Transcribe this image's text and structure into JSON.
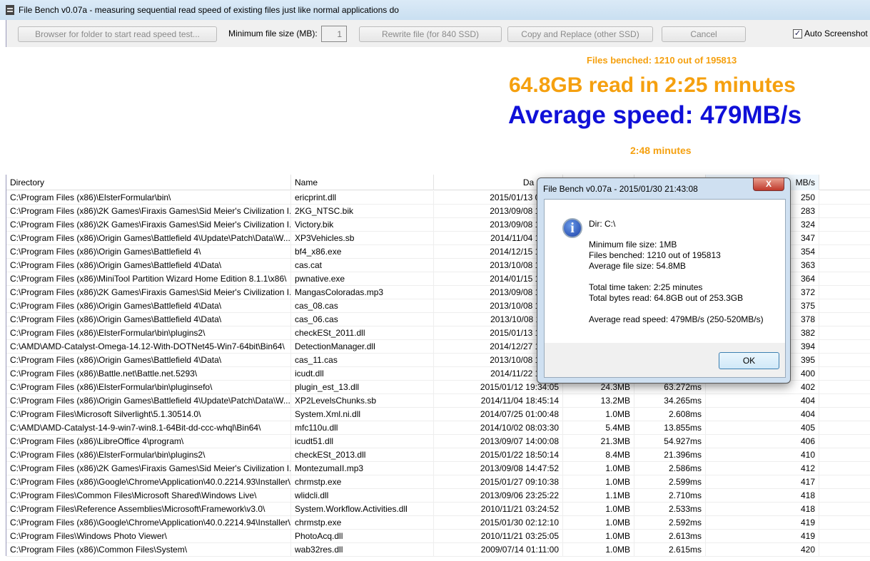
{
  "window": {
    "title": "File Bench v0.07a - measuring sequential read speed of existing files just like normal applications do"
  },
  "toolbar": {
    "browse": "Browser for folder to start read speed test...",
    "min_size_label": "Minimum file size (MB):",
    "min_size_value": "1",
    "rewrite": "Rewrite file (for 840 SSD)",
    "copy_replace": "Copy and Replace (other SSD)",
    "cancel": "Cancel",
    "auto_screenshot": "Auto Screenshot",
    "auto_screenshot_checked": true
  },
  "stats": {
    "files_benched": "Files benched: 1210 out of 195813",
    "read_line": "64.8GB read in  2:25 minutes",
    "avg_speed": "Average speed: 479MB/s",
    "elapsed": "2:48 minutes",
    "colors": {
      "orange": "#f5a00f",
      "blue": "#1010d8"
    }
  },
  "table": {
    "headers": [
      "Directory",
      "Name",
      "Da",
      "",
      "",
      "MB/s"
    ],
    "rows": [
      [
        "C:\\Program Files (x86)\\ElsterFormular\\bin\\",
        "ericprint.dll",
        "2015/01/13 09:33:",
        "",
        "",
        "250"
      ],
      [
        "C:\\Program Files (x86)\\2K Games\\Firaxis Games\\Sid Meier's Civilization I...",
        "2KG_NTSC.bik",
        "2013/09/08 14:47:",
        "",
        "",
        "283"
      ],
      [
        "C:\\Program Files (x86)\\2K Games\\Firaxis Games\\Sid Meier's Civilization I...",
        "Victory.bik",
        "2013/09/08 14:47:",
        "",
        "",
        "324"
      ],
      [
        "C:\\Program Files (x86)\\Origin Games\\Battlefield 4\\Update\\Patch\\Data\\W...",
        "XP3Vehicles.sb",
        "2014/11/04 18:49:",
        "",
        "",
        "347"
      ],
      [
        "C:\\Program Files (x86)\\Origin Games\\Battlefield 4\\",
        "bf4_x86.exe",
        "2014/12/15 18:14:",
        "",
        "",
        "354"
      ],
      [
        "C:\\Program Files (x86)\\Origin Games\\Battlefield 4\\Data\\",
        "cas.cat",
        "2013/10/08 18:23:",
        "",
        "",
        "363"
      ],
      [
        "C:\\Program Files (x86)\\MiniTool Partition Wizard Home Edition 8.1.1\\x86\\",
        "pwnative.exe",
        "2014/01/15 10:12:",
        "",
        "",
        "364"
      ],
      [
        "C:\\Program Files (x86)\\2K Games\\Firaxis Games\\Sid Meier's Civilization I...",
        "MangasColoradas.mp3",
        "2013/09/08 14:47:",
        "",
        "",
        "372"
      ],
      [
        "C:\\Program Files (x86)\\Origin Games\\Battlefield 4\\Data\\",
        "cas_08.cas",
        "2013/10/08 18:13:",
        "",
        "",
        "375"
      ],
      [
        "C:\\Program Files (x86)\\Origin Games\\Battlefield 4\\Data\\",
        "cas_06.cas",
        "2013/10/08 18:11:",
        "",
        "",
        "378"
      ],
      [
        "C:\\Program Files (x86)\\ElsterFormular\\bin\\plugins2\\",
        "checkESt_2011.dll",
        "2015/01/13 10:12:",
        "",
        "",
        "382"
      ],
      [
        "C:\\AMD\\AMD-Catalyst-Omega-14.12-With-DOTNet45-Win7-64bit\\Bin64\\",
        "DetectionManager.dll",
        "2014/12/27 10:20:",
        "",
        "",
        "394"
      ],
      [
        "C:\\Program Files (x86)\\Origin Games\\Battlefield 4\\Data\\",
        "cas_11.cas",
        "2013/10/08 18:15:",
        "",
        "",
        "395"
      ],
      [
        "C:\\Program Files (x86)\\Battle.net\\Battle.net.5293\\",
        "icudt.dll",
        "2014/11/22 18:44:",
        "",
        "",
        "400"
      ],
      [
        "C:\\Program Files (x86)\\ElsterFormular\\bin\\pluginsefo\\",
        "plugin_est_13.dll",
        "2015/01/12 19:34:05",
        "24.3MB",
        "63.272ms",
        "402"
      ],
      [
        "C:\\Program Files (x86)\\Origin Games\\Battlefield 4\\Update\\Patch\\Data\\W...",
        "XP2LevelsChunks.sb",
        "2014/11/04 18:45:14",
        "13.2MB",
        "34.265ms",
        "404"
      ],
      [
        "C:\\Program Files\\Microsoft Silverlight\\5.1.30514.0\\",
        "System.Xml.ni.dll",
        "2014/07/25 01:00:48",
        "1.0MB",
        "2.608ms",
        "404"
      ],
      [
        "C:\\AMD\\AMD-Catalyst-14-9-win7-win8.1-64Bit-dd-ccc-whql\\Bin64\\",
        "mfc110u.dll",
        "2014/10/02 08:03:30",
        "5.4MB",
        "13.855ms",
        "405"
      ],
      [
        "C:\\Program Files (x86)\\LibreOffice 4\\program\\",
        "icudt51.dll",
        "2013/09/07 14:00:08",
        "21.3MB",
        "54.927ms",
        "406"
      ],
      [
        "C:\\Program Files (x86)\\ElsterFormular\\bin\\plugins2\\",
        "checkESt_2013.dll",
        "2015/01/22 18:50:14",
        "8.4MB",
        "21.396ms",
        "410"
      ],
      [
        "C:\\Program Files (x86)\\2K Games\\Firaxis Games\\Sid Meier's Civilization I...",
        "MontezumaII.mp3",
        "2013/09/08 14:47:52",
        "1.0MB",
        "2.586ms",
        "412"
      ],
      [
        "C:\\Program Files (x86)\\Google\\Chrome\\Application\\40.0.2214.93\\Installer\\",
        "chrmstp.exe",
        "2015/01/27 09:10:38",
        "1.0MB",
        "2.599ms",
        "417"
      ],
      [
        "C:\\Program Files\\Common Files\\Microsoft Shared\\Windows Live\\",
        "wlidcli.dll",
        "2013/09/06 23:25:22",
        "1.1MB",
        "2.710ms",
        "418"
      ],
      [
        "C:\\Program Files\\Reference Assemblies\\Microsoft\\Framework\\v3.0\\",
        "System.Workflow.Activities.dll",
        "2010/11/21 03:24:52",
        "1.0MB",
        "2.533ms",
        "418"
      ],
      [
        "C:\\Program Files (x86)\\Google\\Chrome\\Application\\40.0.2214.94\\Installer\\",
        "chrmstp.exe",
        "2015/01/30 02:12:10",
        "1.0MB",
        "2.592ms",
        "419"
      ],
      [
        "C:\\Program Files\\Windows Photo Viewer\\",
        "PhotoAcq.dll",
        "2010/11/21 03:25:05",
        "1.0MB",
        "2.613ms",
        "419"
      ],
      [
        "C:\\Program Files (x86)\\Common Files\\System\\",
        "wab32res.dll",
        "2009/07/14 01:11:00",
        "1.0MB",
        "2.615ms",
        "420"
      ]
    ]
  },
  "dialog": {
    "title": "File Bench v0.07a  -  2015/01/30 21:43:08",
    "close": "X",
    "icon": "info-icon",
    "lines": [
      "Dir: C:\\",
      "Minimum file size: 1MB",
      "Files benched: 1210 out of 195813",
      "Average file size: 54.8MB",
      "Total time taken:  2:25 minutes",
      "Total bytes read: 64.8GB out of 253.3GB",
      "Average read speed: 479MB/s  (250-520MB/s)"
    ],
    "ok": "OK"
  }
}
